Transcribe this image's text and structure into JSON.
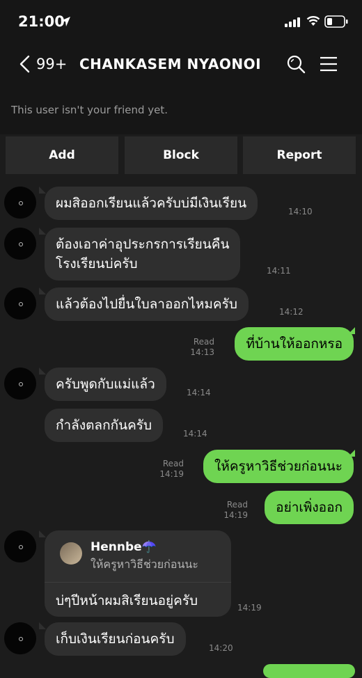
{
  "status_bar": {
    "time": "21:00"
  },
  "header": {
    "back_count": "99+",
    "title": "CHANKASEM NYAONOI",
    "notice": "This user isn't your friend yet."
  },
  "actions": {
    "add": "Add",
    "block": "Block",
    "report": "Report"
  },
  "colors": {
    "outgoing_bubble": "#6fd452",
    "incoming_bubble": "#2f2f2f",
    "background": "#1c1c1c"
  },
  "messages": [
    {
      "direction": "in",
      "text": "ผมสิออกเรียนแล้วครับบ่มีเงินเรียน",
      "time": "14:10"
    },
    {
      "direction": "in",
      "text": "ต้องเอาค่าอุประกรการเรียนคืน\nโรงเรียนบ่ครับ",
      "time": "14:11"
    },
    {
      "direction": "in",
      "text": "แล้วต้องไปยื่นใบลาออกไหมครับ",
      "time": "14:12"
    },
    {
      "direction": "out",
      "text": "ที่บ้านให้ออกหรอ",
      "read": "Read",
      "time": "14:13"
    },
    {
      "direction": "in",
      "text": "ครับพูดกับแม่แล้ว",
      "time": "14:14"
    },
    {
      "direction": "in",
      "text": "กำลังตลกกันครับ",
      "time": "14:14"
    },
    {
      "direction": "out",
      "text": "ให้ครูหาวิธีช่วยก่อนนะ",
      "read": "Read",
      "time": "14:19"
    },
    {
      "direction": "out",
      "text": "อย่าเพิ่งออก",
      "read": "Read",
      "time": "14:19"
    },
    {
      "direction": "in",
      "reply_to": {
        "name": "Hennbe☂️",
        "quote": "ให้ครูหาวิธีช่วยก่อนนะ"
      },
      "text": "บ่ๆปีหน้าผมสิเรียนอยู่ครับ",
      "time": "14:19"
    },
    {
      "direction": "in",
      "text": "เก็บเงินเรียนก่อนครับ",
      "time": "14:20"
    }
  ]
}
